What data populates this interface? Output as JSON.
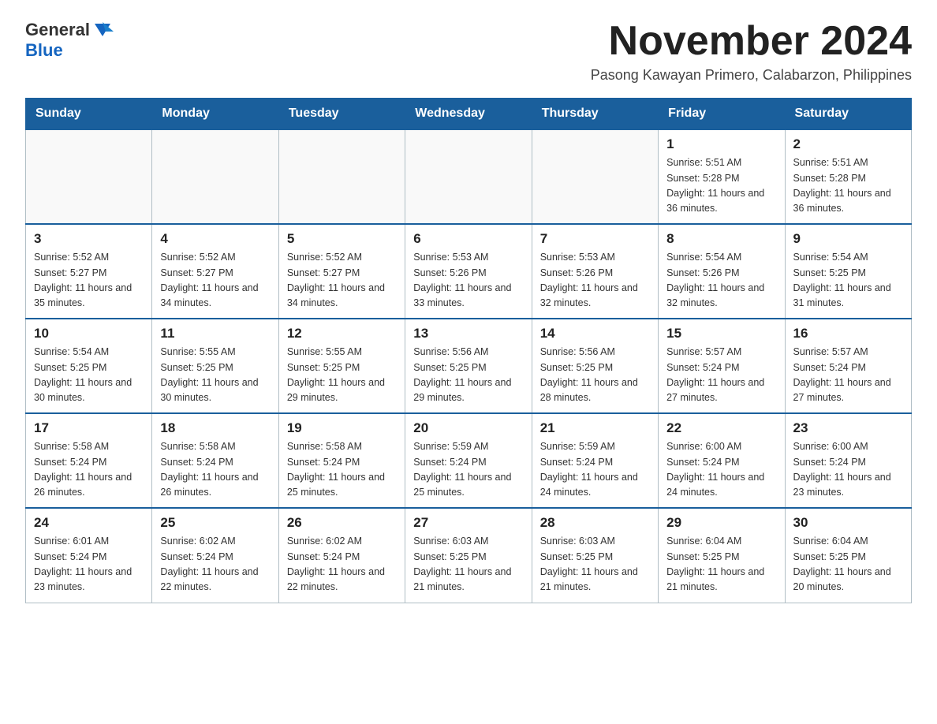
{
  "logo": {
    "general": "General",
    "blue": "Blue",
    "alt": "GeneralBlue logo"
  },
  "title": "November 2024",
  "subtitle": "Pasong Kawayan Primero, Calabarzon, Philippines",
  "days_of_week": [
    "Sunday",
    "Monday",
    "Tuesday",
    "Wednesday",
    "Thursday",
    "Friday",
    "Saturday"
  ],
  "weeks": [
    [
      {
        "day": "",
        "info": ""
      },
      {
        "day": "",
        "info": ""
      },
      {
        "day": "",
        "info": ""
      },
      {
        "day": "",
        "info": ""
      },
      {
        "day": "",
        "info": ""
      },
      {
        "day": "1",
        "info": "Sunrise: 5:51 AM\nSunset: 5:28 PM\nDaylight: 11 hours and 36 minutes."
      },
      {
        "day": "2",
        "info": "Sunrise: 5:51 AM\nSunset: 5:28 PM\nDaylight: 11 hours and 36 minutes."
      }
    ],
    [
      {
        "day": "3",
        "info": "Sunrise: 5:52 AM\nSunset: 5:27 PM\nDaylight: 11 hours and 35 minutes."
      },
      {
        "day": "4",
        "info": "Sunrise: 5:52 AM\nSunset: 5:27 PM\nDaylight: 11 hours and 34 minutes."
      },
      {
        "day": "5",
        "info": "Sunrise: 5:52 AM\nSunset: 5:27 PM\nDaylight: 11 hours and 34 minutes."
      },
      {
        "day": "6",
        "info": "Sunrise: 5:53 AM\nSunset: 5:26 PM\nDaylight: 11 hours and 33 minutes."
      },
      {
        "day": "7",
        "info": "Sunrise: 5:53 AM\nSunset: 5:26 PM\nDaylight: 11 hours and 32 minutes."
      },
      {
        "day": "8",
        "info": "Sunrise: 5:54 AM\nSunset: 5:26 PM\nDaylight: 11 hours and 32 minutes."
      },
      {
        "day": "9",
        "info": "Sunrise: 5:54 AM\nSunset: 5:25 PM\nDaylight: 11 hours and 31 minutes."
      }
    ],
    [
      {
        "day": "10",
        "info": "Sunrise: 5:54 AM\nSunset: 5:25 PM\nDaylight: 11 hours and 30 minutes."
      },
      {
        "day": "11",
        "info": "Sunrise: 5:55 AM\nSunset: 5:25 PM\nDaylight: 11 hours and 30 minutes."
      },
      {
        "day": "12",
        "info": "Sunrise: 5:55 AM\nSunset: 5:25 PM\nDaylight: 11 hours and 29 minutes."
      },
      {
        "day": "13",
        "info": "Sunrise: 5:56 AM\nSunset: 5:25 PM\nDaylight: 11 hours and 29 minutes."
      },
      {
        "day": "14",
        "info": "Sunrise: 5:56 AM\nSunset: 5:25 PM\nDaylight: 11 hours and 28 minutes."
      },
      {
        "day": "15",
        "info": "Sunrise: 5:57 AM\nSunset: 5:24 PM\nDaylight: 11 hours and 27 minutes."
      },
      {
        "day": "16",
        "info": "Sunrise: 5:57 AM\nSunset: 5:24 PM\nDaylight: 11 hours and 27 minutes."
      }
    ],
    [
      {
        "day": "17",
        "info": "Sunrise: 5:58 AM\nSunset: 5:24 PM\nDaylight: 11 hours and 26 minutes."
      },
      {
        "day": "18",
        "info": "Sunrise: 5:58 AM\nSunset: 5:24 PM\nDaylight: 11 hours and 26 minutes."
      },
      {
        "day": "19",
        "info": "Sunrise: 5:58 AM\nSunset: 5:24 PM\nDaylight: 11 hours and 25 minutes."
      },
      {
        "day": "20",
        "info": "Sunrise: 5:59 AM\nSunset: 5:24 PM\nDaylight: 11 hours and 25 minutes."
      },
      {
        "day": "21",
        "info": "Sunrise: 5:59 AM\nSunset: 5:24 PM\nDaylight: 11 hours and 24 minutes."
      },
      {
        "day": "22",
        "info": "Sunrise: 6:00 AM\nSunset: 5:24 PM\nDaylight: 11 hours and 24 minutes."
      },
      {
        "day": "23",
        "info": "Sunrise: 6:00 AM\nSunset: 5:24 PM\nDaylight: 11 hours and 23 minutes."
      }
    ],
    [
      {
        "day": "24",
        "info": "Sunrise: 6:01 AM\nSunset: 5:24 PM\nDaylight: 11 hours and 23 minutes."
      },
      {
        "day": "25",
        "info": "Sunrise: 6:02 AM\nSunset: 5:24 PM\nDaylight: 11 hours and 22 minutes."
      },
      {
        "day": "26",
        "info": "Sunrise: 6:02 AM\nSunset: 5:24 PM\nDaylight: 11 hours and 22 minutes."
      },
      {
        "day": "27",
        "info": "Sunrise: 6:03 AM\nSunset: 5:25 PM\nDaylight: 11 hours and 21 minutes."
      },
      {
        "day": "28",
        "info": "Sunrise: 6:03 AM\nSunset: 5:25 PM\nDaylight: 11 hours and 21 minutes."
      },
      {
        "day": "29",
        "info": "Sunrise: 6:04 AM\nSunset: 5:25 PM\nDaylight: 11 hours and 21 minutes."
      },
      {
        "day": "30",
        "info": "Sunrise: 6:04 AM\nSunset: 5:25 PM\nDaylight: 11 hours and 20 minutes."
      }
    ]
  ]
}
